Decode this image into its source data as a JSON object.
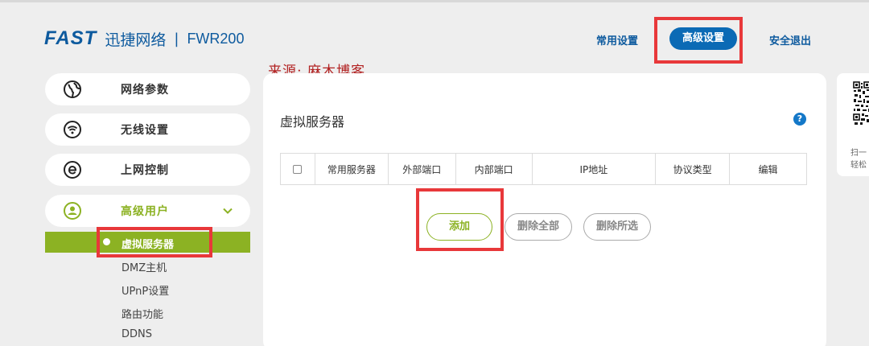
{
  "header": {
    "logo": "FAST",
    "brand_cn": "迅捷网络",
    "separator": "|",
    "model": "FWR200",
    "nav": {
      "common": "常用设置",
      "advanced": "高级设置",
      "logout": "安全退出"
    }
  },
  "watermark": "来源: 麻木博客",
  "sidebar": {
    "items": [
      {
        "label": "网络参数",
        "icon": "globe-icon"
      },
      {
        "label": "无线设置",
        "icon": "wifi-icon"
      },
      {
        "label": "上网控制",
        "icon": "internet-e-icon"
      },
      {
        "label": "高级用户",
        "icon": "user-icon"
      }
    ],
    "subitems": [
      {
        "label": "虚拟服务器",
        "active": true
      },
      {
        "label": "DMZ主机"
      },
      {
        "label": "UPnP设置"
      },
      {
        "label": "路由功能"
      },
      {
        "label": "DDNS"
      }
    ]
  },
  "main": {
    "title": "虚拟服务器",
    "help": "?",
    "table": {
      "columns": [
        "常用服务器",
        "外部端口",
        "内部端口",
        "IP地址",
        "协议类型",
        "编辑"
      ]
    },
    "buttons": {
      "add": "添加",
      "delete_all": "删除全部",
      "delete_selected": "删除所选"
    }
  },
  "right_card": {
    "text1": "扫一",
    "text2": "轻松"
  },
  "colors": {
    "brand_blue": "#0d5a9e",
    "nav_active": "#0b6ab5",
    "accent_green": "#8cb223",
    "highlight_red": "#e8383a"
  }
}
